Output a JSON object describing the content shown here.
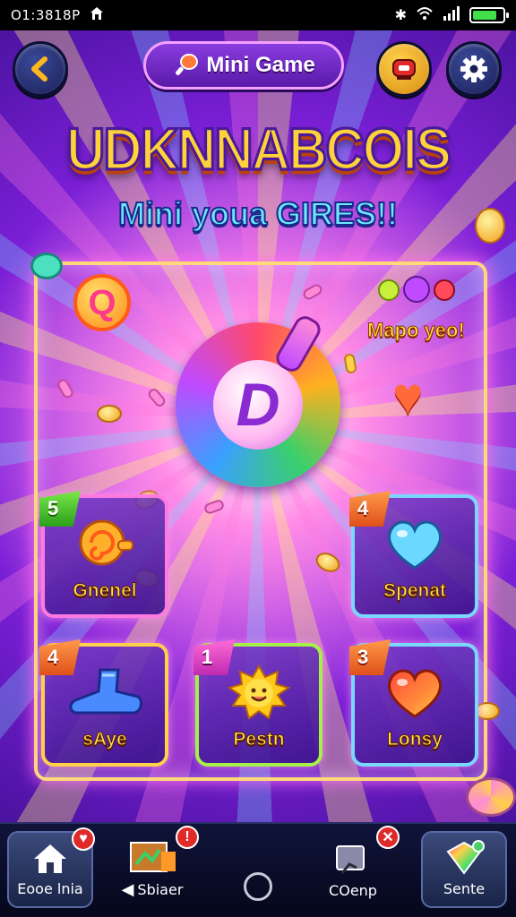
{
  "status_bar": {
    "time": "O1:3818P",
    "battery_level": 0.8,
    "colors": {
      "battery": "#42e04a"
    }
  },
  "header": {
    "title": "Mini Game",
    "back_icon": "chevron-left-icon",
    "alert_icon": "alert-icon",
    "settings_icon": "gear-icon"
  },
  "logo": {
    "title": "UDKNNABCOIS",
    "subtitle": "Mini youa GIRES!!"
  },
  "board": {
    "promo_label": "Mapo yeo!",
    "center_emblem_letter": "D",
    "q_badge_letter": "Q"
  },
  "tiles": [
    {
      "badge": "5",
      "label": "Gnenel",
      "icon": "swirl-icon"
    },
    {
      "badge": "4",
      "label": "Spenat",
      "icon": "heart-bubble-icon"
    },
    {
      "badge": "4",
      "label": "sAye",
      "icon": "boot-icon"
    },
    {
      "badge": "1",
      "label": "Pestn",
      "icon": "sun-icon"
    },
    {
      "badge": "3",
      "label": "Lonsy",
      "icon": "heart-icon"
    }
  ],
  "bottom_nav": {
    "items": [
      {
        "label": "Eooe lnia",
        "icon": "home-icon",
        "alert": "♥"
      },
      {
        "label": "Sbiaer",
        "icon": "share-icon",
        "alert": "!"
      },
      {
        "label": "COenp",
        "icon": "compare-icon",
        "alert": "✕"
      },
      {
        "label": "Sente",
        "icon": "candy-icon",
        "alert": ""
      }
    ]
  }
}
